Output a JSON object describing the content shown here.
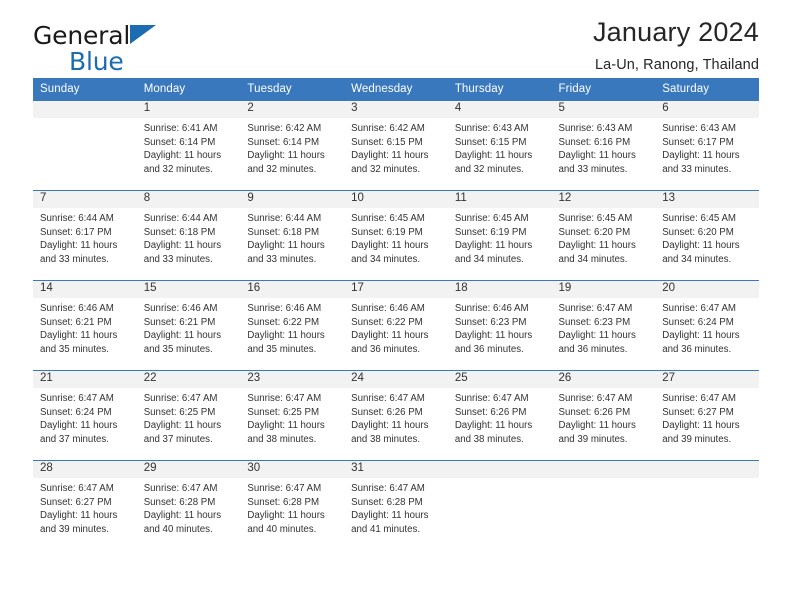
{
  "brand": {
    "line1": "General",
    "line2": "Blue",
    "triangle_color": "#1b6cb0",
    "icon": "triangle-logo-icon"
  },
  "header": {
    "title": "January 2024",
    "location": "La-Un, Ranong, Thailand"
  },
  "theme": {
    "header_blue": "#3a78bd",
    "daynum_band": "#f2f2f2",
    "text": "#333333"
  },
  "weekday_headers": [
    "Sunday",
    "Monday",
    "Tuesday",
    "Wednesday",
    "Thursday",
    "Friday",
    "Saturday"
  ],
  "labels": {
    "sunrise_prefix": "Sunrise:",
    "sunset_prefix": "Sunset:",
    "daylight_prefix": "Daylight:"
  },
  "weeks": [
    [
      {
        "day": "",
        "sunrise": "",
        "sunset": "",
        "daylight": "",
        "empty": true
      },
      {
        "day": "1",
        "sunrise": "Sunrise: 6:41 AM",
        "sunset": "Sunset: 6:14 PM",
        "daylight": "Daylight: 11 hours and 32 minutes."
      },
      {
        "day": "2",
        "sunrise": "Sunrise: 6:42 AM",
        "sunset": "Sunset: 6:14 PM",
        "daylight": "Daylight: 11 hours and 32 minutes."
      },
      {
        "day": "3",
        "sunrise": "Sunrise: 6:42 AM",
        "sunset": "Sunset: 6:15 PM",
        "daylight": "Daylight: 11 hours and 32 minutes."
      },
      {
        "day": "4",
        "sunrise": "Sunrise: 6:43 AM",
        "sunset": "Sunset: 6:15 PM",
        "daylight": "Daylight: 11 hours and 32 minutes."
      },
      {
        "day": "5",
        "sunrise": "Sunrise: 6:43 AM",
        "sunset": "Sunset: 6:16 PM",
        "daylight": "Daylight: 11 hours and 33 minutes."
      },
      {
        "day": "6",
        "sunrise": "Sunrise: 6:43 AM",
        "sunset": "Sunset: 6:17 PM",
        "daylight": "Daylight: 11 hours and 33 minutes."
      }
    ],
    [
      {
        "day": "7",
        "sunrise": "Sunrise: 6:44 AM",
        "sunset": "Sunset: 6:17 PM",
        "daylight": "Daylight: 11 hours and 33 minutes."
      },
      {
        "day": "8",
        "sunrise": "Sunrise: 6:44 AM",
        "sunset": "Sunset: 6:18 PM",
        "daylight": "Daylight: 11 hours and 33 minutes."
      },
      {
        "day": "9",
        "sunrise": "Sunrise: 6:44 AM",
        "sunset": "Sunset: 6:18 PM",
        "daylight": "Daylight: 11 hours and 33 minutes."
      },
      {
        "day": "10",
        "sunrise": "Sunrise: 6:45 AM",
        "sunset": "Sunset: 6:19 PM",
        "daylight": "Daylight: 11 hours and 34 minutes."
      },
      {
        "day": "11",
        "sunrise": "Sunrise: 6:45 AM",
        "sunset": "Sunset: 6:19 PM",
        "daylight": "Daylight: 11 hours and 34 minutes."
      },
      {
        "day": "12",
        "sunrise": "Sunrise: 6:45 AM",
        "sunset": "Sunset: 6:20 PM",
        "daylight": "Daylight: 11 hours and 34 minutes."
      },
      {
        "day": "13",
        "sunrise": "Sunrise: 6:45 AM",
        "sunset": "Sunset: 6:20 PM",
        "daylight": "Daylight: 11 hours and 34 minutes."
      }
    ],
    [
      {
        "day": "14",
        "sunrise": "Sunrise: 6:46 AM",
        "sunset": "Sunset: 6:21 PM",
        "daylight": "Daylight: 11 hours and 35 minutes."
      },
      {
        "day": "15",
        "sunrise": "Sunrise: 6:46 AM",
        "sunset": "Sunset: 6:21 PM",
        "daylight": "Daylight: 11 hours and 35 minutes."
      },
      {
        "day": "16",
        "sunrise": "Sunrise: 6:46 AM",
        "sunset": "Sunset: 6:22 PM",
        "daylight": "Daylight: 11 hours and 35 minutes."
      },
      {
        "day": "17",
        "sunrise": "Sunrise: 6:46 AM",
        "sunset": "Sunset: 6:22 PM",
        "daylight": "Daylight: 11 hours and 36 minutes."
      },
      {
        "day": "18",
        "sunrise": "Sunrise: 6:46 AM",
        "sunset": "Sunset: 6:23 PM",
        "daylight": "Daylight: 11 hours and 36 minutes."
      },
      {
        "day": "19",
        "sunrise": "Sunrise: 6:47 AM",
        "sunset": "Sunset: 6:23 PM",
        "daylight": "Daylight: 11 hours and 36 minutes."
      },
      {
        "day": "20",
        "sunrise": "Sunrise: 6:47 AM",
        "sunset": "Sunset: 6:24 PM",
        "daylight": "Daylight: 11 hours and 36 minutes."
      }
    ],
    [
      {
        "day": "21",
        "sunrise": "Sunrise: 6:47 AM",
        "sunset": "Sunset: 6:24 PM",
        "daylight": "Daylight: 11 hours and 37 minutes."
      },
      {
        "day": "22",
        "sunrise": "Sunrise: 6:47 AM",
        "sunset": "Sunset: 6:25 PM",
        "daylight": "Daylight: 11 hours and 37 minutes."
      },
      {
        "day": "23",
        "sunrise": "Sunrise: 6:47 AM",
        "sunset": "Sunset: 6:25 PM",
        "daylight": "Daylight: 11 hours and 38 minutes."
      },
      {
        "day": "24",
        "sunrise": "Sunrise: 6:47 AM",
        "sunset": "Sunset: 6:26 PM",
        "daylight": "Daylight: 11 hours and 38 minutes."
      },
      {
        "day": "25",
        "sunrise": "Sunrise: 6:47 AM",
        "sunset": "Sunset: 6:26 PM",
        "daylight": "Daylight: 11 hours and 38 minutes."
      },
      {
        "day": "26",
        "sunrise": "Sunrise: 6:47 AM",
        "sunset": "Sunset: 6:26 PM",
        "daylight": "Daylight: 11 hours and 39 minutes."
      },
      {
        "day": "27",
        "sunrise": "Sunrise: 6:47 AM",
        "sunset": "Sunset: 6:27 PM",
        "daylight": "Daylight: 11 hours and 39 minutes."
      }
    ],
    [
      {
        "day": "28",
        "sunrise": "Sunrise: 6:47 AM",
        "sunset": "Sunset: 6:27 PM",
        "daylight": "Daylight: 11 hours and 39 minutes."
      },
      {
        "day": "29",
        "sunrise": "Sunrise: 6:47 AM",
        "sunset": "Sunset: 6:28 PM",
        "daylight": "Daylight: 11 hours and 40 minutes."
      },
      {
        "day": "30",
        "sunrise": "Sunrise: 6:47 AM",
        "sunset": "Sunset: 6:28 PM",
        "daylight": "Daylight: 11 hours and 40 minutes."
      },
      {
        "day": "31",
        "sunrise": "Sunrise: 6:47 AM",
        "sunset": "Sunset: 6:28 PM",
        "daylight": "Daylight: 11 hours and 41 minutes."
      },
      {
        "day": "",
        "sunrise": "",
        "sunset": "",
        "daylight": "",
        "empty": true
      },
      {
        "day": "",
        "sunrise": "",
        "sunset": "",
        "daylight": "",
        "empty": true
      },
      {
        "day": "",
        "sunrise": "",
        "sunset": "",
        "daylight": "",
        "empty": true
      }
    ]
  ]
}
